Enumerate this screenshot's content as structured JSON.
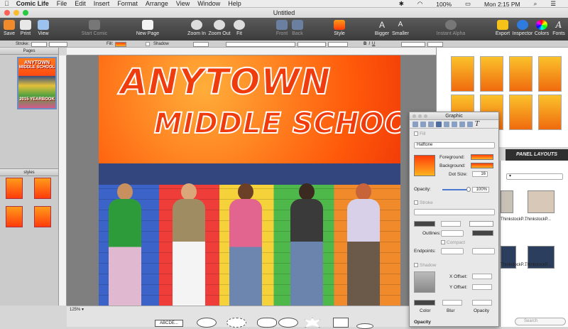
{
  "menubar": {
    "app": "Comic Life",
    "items": [
      "File",
      "Edit",
      "Insert",
      "Format",
      "Arrange",
      "View",
      "Window",
      "Help"
    ],
    "battery": "100%",
    "clock": "Mon 2:15 PM"
  },
  "window": {
    "title": "Untitled"
  },
  "toolbar": {
    "save": "Save",
    "print": "Print",
    "view": "View",
    "start_comic": "Start Comic",
    "new_page": "New Page",
    "zoom_in": "Zoom In",
    "zoom_out": "Zoom Out",
    "fit": "Fit",
    "front": "Front",
    "back": "Back",
    "style": "Style",
    "bigger": "Bigger",
    "smaller": "Smaller",
    "instant_alpha": "Instant Alpha",
    "export": "Export",
    "inspector": "Inspector",
    "colors": "Colors",
    "fonts": "Fonts"
  },
  "stylebar": {
    "stroke_label": "Stroke:",
    "fill_label": "Fill:",
    "shadow_label": "Shadow",
    "bold": "B",
    "italic": "I",
    "underline": "U"
  },
  "pages_panel": {
    "title": "Pages",
    "thumb_line1": "ANYTOWN",
    "thumb_line2": "MIDDLE SCHOOL",
    "thumb_line3": "2015 YEARBOOK"
  },
  "styles_panel": {
    "title": "styles"
  },
  "canvas": {
    "headline1": "ANYTOWN",
    "headline2": "MIDDLE SCHOOL",
    "zoom": "125%"
  },
  "object_strip": {
    "caption_sample": "ABCDE..."
  },
  "panel_layouts": {
    "tab": "PANEL LAYOUTS"
  },
  "image_browser": {
    "items": [
      "ThinkstockP...",
      "ThinkstockP...",
      "ThinkstockP...",
      "ThinkstockP..."
    ],
    "search_placeholder": "Search"
  },
  "inspector": {
    "title": "Graphic",
    "fill_label": "Fill",
    "fill_type": "Halftone",
    "foreground_label": "Foreground:",
    "background_label": "Background:",
    "dot_size_label": "Dot Size:",
    "dot_size": "16",
    "opacity_label": "Opacity:",
    "opacity": "100%",
    "stroke_label": "Stroke",
    "outlines_label": "Outlines:",
    "compact_label": "Compact",
    "endpoints_label": "Endpoints:",
    "shadow_label": "Shadow",
    "x_offset_label": "X Offset:",
    "y_offset_label": "Y Offset:",
    "color_label": "Color",
    "blur_label": "Blur",
    "opacity_col_label": "Opacity",
    "opacity_section": "Opacity"
  },
  "colors": {
    "toolbar_bg": "#4a4a4a",
    "accent": "#ff5a0a",
    "selection": "#6d8ec2"
  }
}
